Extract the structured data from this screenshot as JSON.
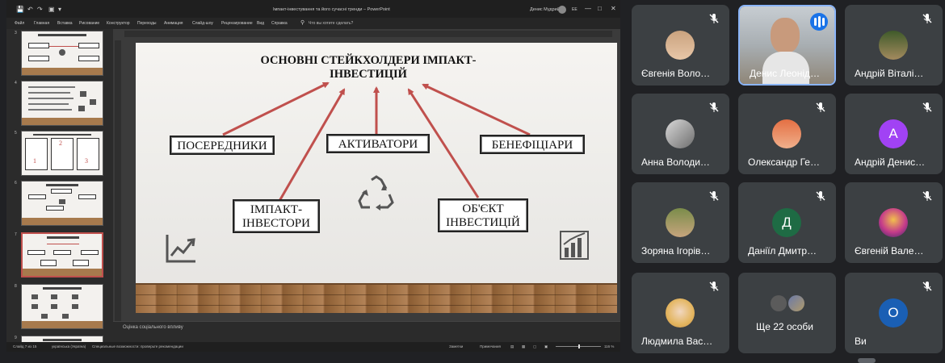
{
  "powerpoint": {
    "quick_access": {
      "save_icon": "save-icon",
      "undo_icon": "undo-icon",
      "redo_icon": "redo-icon"
    },
    "document_title": "Імпакт-інвестування та його сучасні тренди  –  PowerPoint",
    "user_name": "Денис Мудрий",
    "user_initials": "ЕЕ",
    "ribbon_tabs": [
      "Файл",
      "Главная",
      "Вставка",
      "Рисование",
      "Конструктор",
      "Переходы",
      "Анимация",
      "Слайд-шоу",
      "Рецензирование",
      "Вид",
      "Справка"
    ],
    "tell_me": "Что вы хотите сделать?",
    "thumbnails": [
      {
        "number": "3"
      },
      {
        "number": "4"
      },
      {
        "number": "5",
        "labels": [
          "2",
          "1",
          "3"
        ]
      },
      {
        "number": "6"
      },
      {
        "number": "7"
      },
      {
        "number": "8"
      },
      {
        "number": "9"
      }
    ],
    "slide": {
      "title": "ОСНОВНІ СТЕЙКХОЛДЕРИ ІМПАКТ-ІНВЕСТИЦІЙ",
      "boxes": {
        "intermediaries": "ПОСЕРЕДНИКИ",
        "activators": "АКТИВАТОРИ",
        "beneficiaries": "БЕНЕФІЦІАРИ",
        "impact_investors": "ІМПАКТ-ІНВЕСТОРИ",
        "investment_object": "ОБ'ЄКТ ІНВЕСТИЦІЙ"
      },
      "arrow_color": "#c0504d"
    },
    "notes_text": "Оцінка соціального впливу",
    "status": {
      "slide_counter": "Слайд 7 из 15",
      "language": "українська (Україна)",
      "accessibility": "Специальные возможности: проверьте рекомендации",
      "notes_button": "Заметки",
      "comments_button": "Примечания",
      "zoom": "116 %"
    }
  },
  "meet": {
    "participants": [
      {
        "name": "Євгенія Воло…",
        "muted": true,
        "avatar_type": "photo"
      },
      {
        "name": "Денис Леонід…",
        "muted": false,
        "speaking": true,
        "avatar_type": "video"
      },
      {
        "name": "Андрій Віталі…",
        "muted": true,
        "avatar_type": "photo"
      },
      {
        "name": "Анна Володи…",
        "muted": true,
        "avatar_type": "photo"
      },
      {
        "name": "Олександр Ге…",
        "muted": true,
        "avatar_type": "photo"
      },
      {
        "name": "Андрій Денис…",
        "muted": true,
        "avatar_type": "letter",
        "letter": "А",
        "color": "#a142f4"
      },
      {
        "name": "Зоряна Ігорів…",
        "muted": true,
        "avatar_type": "photo"
      },
      {
        "name": "Даніїл Дмитр…",
        "muted": true,
        "avatar_type": "letter",
        "letter": "Д",
        "color": "#1e6b44"
      },
      {
        "name": "Євгеній Вале…",
        "muted": true,
        "avatar_type": "photo"
      },
      {
        "name": "Людмила Вас…",
        "muted": true,
        "avatar_type": "photo"
      },
      {
        "name": "Ще 22 особи",
        "muted": false,
        "avatar_type": "group"
      },
      {
        "name": "Ви",
        "muted": true,
        "avatar_type": "letter",
        "letter": "О",
        "color": "#1a5fb4"
      }
    ]
  }
}
